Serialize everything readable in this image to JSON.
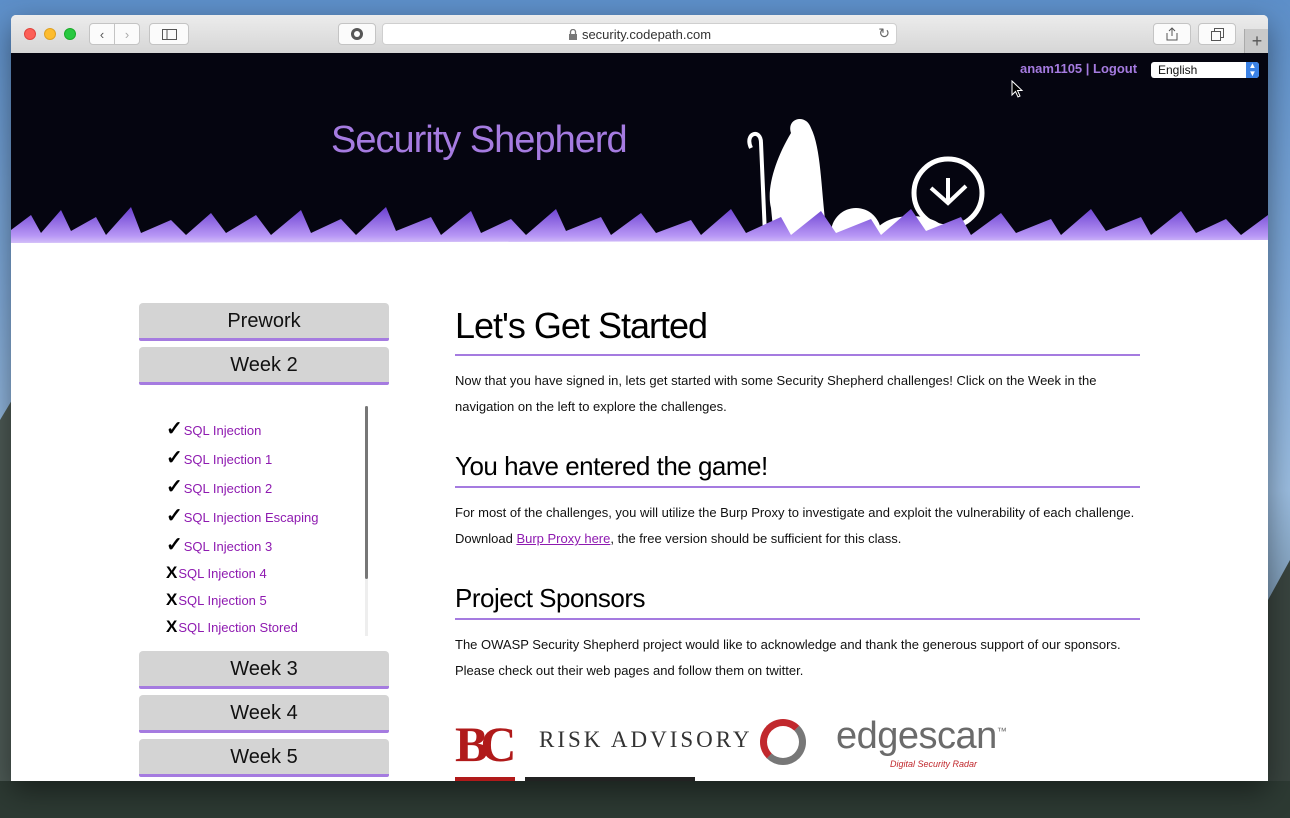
{
  "browser": {
    "url": "security.codepath.com"
  },
  "header": {
    "site_title": "Security Shepherd",
    "username": "anam1105",
    "separator": " | ",
    "logout": "Logout",
    "language": "English"
  },
  "sidebar": {
    "prework": "Prework",
    "week2": "Week 2",
    "week3": "Week 3",
    "week4": "Week 4",
    "week5": "Week 5",
    "challenges": [
      {
        "mark": "✓",
        "label": "SQL Injection",
        "completed": true
      },
      {
        "mark": "✓",
        "label": "SQL Injection 1",
        "completed": true
      },
      {
        "mark": "✓",
        "label": "SQL Injection 2",
        "completed": true
      },
      {
        "mark": "✓",
        "label": "SQL Injection Escaping",
        "completed": true
      },
      {
        "mark": "✓",
        "label": "SQL Injection 3",
        "completed": true
      },
      {
        "mark": "X",
        "label": "SQL Injection 4",
        "completed": false
      },
      {
        "mark": "X",
        "label": "SQL Injection 5",
        "completed": false
      },
      {
        "mark": "X",
        "label": "SQL Injection Stored",
        "completed": false
      }
    ]
  },
  "main": {
    "heading": "Let's Get Started",
    "intro": "Now that you have signed in, lets get started with some Security Shepherd challenges! Click on the Week in the navigation on the left to explore the challenges.",
    "game_heading": "You have entered the game!",
    "game_text_before": "For most of the challenges, you will utilize the Burp Proxy to investigate and exploit the vulnerability of each challenge. Download ",
    "game_link": "Burp Proxy here",
    "game_text_after": ", the free version should be sufficient for this class.",
    "sponsors_heading": "Project Sponsors",
    "sponsors_text": "The OWASP Security Shepherd project would like to acknowledge and thank the generous support of our sponsors. Please check out their web pages and follow them on twitter.",
    "sponsors": {
      "bc_logo": "BC",
      "risk_advisory": "RISK ADVISORY",
      "edgescan": "edgescan",
      "edgescan_tm": "™",
      "edgescan_tagline": "Digital Security Radar"
    }
  },
  "colors": {
    "accent": "#a57be0",
    "link": "#8e1ab0",
    "header_bg": "#050510"
  }
}
